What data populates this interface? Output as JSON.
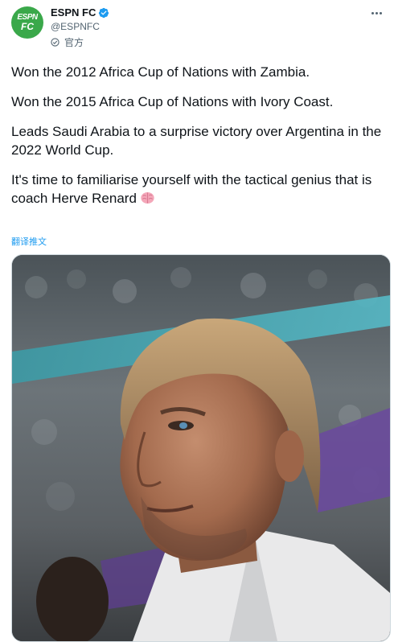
{
  "account": {
    "display_name": "ESPN FC",
    "handle": "@ESPNFC",
    "label": "官方",
    "avatar_text_top": "ESPN",
    "avatar_text_bottom": "FC"
  },
  "tweet": {
    "paragraphs": [
      "Won the 2012 Africa Cup of Nations with Zambia.",
      "Won the 2015 Africa Cup of Nations with Ivory Coast.",
      "Leads Saudi Arabia to a surprise victory over Argentina in the 2022 World Cup.",
      "It's time to familiarise yourself with the tactical genius that is coach Herve Renard"
    ],
    "emoji": "brain-emoji",
    "translate_link": "翻译推文"
  },
  "colors": {
    "brand": "#3aa84a",
    "verified": "#1d9bf0",
    "link": "#1d9bf0"
  },
  "icons": {
    "verified": "verified-badge-icon",
    "official_label": "official-circle-icon",
    "more": "more-horizontal-icon"
  }
}
